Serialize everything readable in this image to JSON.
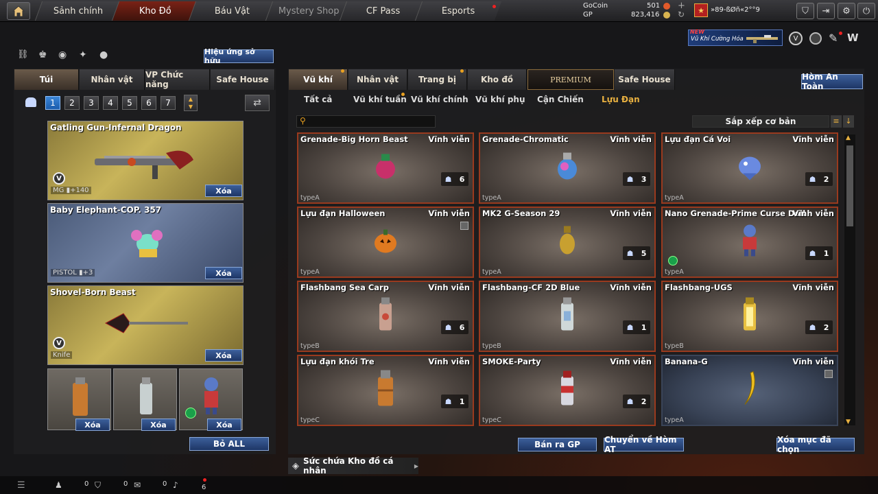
{
  "nav": {
    "tabs": [
      "Sảnh chính",
      "Kho Đồ",
      "Báu Vật",
      "Mystery Shop",
      "CF Pass",
      "Esports"
    ]
  },
  "currency": {
    "gocoin_label": "GoCoin",
    "gocoin": "501",
    "gp_label": "GP",
    "gp": "823,416"
  },
  "player": {
    "name": "»89-ßØñ«2°°9"
  },
  "promo": {
    "new": "NEW",
    "label": "Vũ Khí Cường Hóa"
  },
  "left": {
    "effect_button": "Hiệu ứng sở hữu",
    "tabs": [
      "Túi",
      "Nhân vật",
      "VP Chức năng",
      "Safe House"
    ],
    "pages": [
      "1",
      "2",
      "3",
      "4",
      "5",
      "6",
      "7"
    ],
    "cards": [
      {
        "name": "Gatling Gun-Infernal Dragon",
        "type": "MG",
        "bonus": "+140",
        "delete": "Xóa"
      },
      {
        "name": "Baby Elephant-COP. 357",
        "type": "PISTOL",
        "bonus": "+3",
        "delete": "Xóa"
      },
      {
        "name": "Shovel-Born Beast",
        "type": "Knife",
        "bonus": "",
        "delete": "Xóa"
      }
    ],
    "small_delete": "Xóa",
    "remove_all": "Bỏ ALL"
  },
  "right": {
    "tabs": [
      "Vũ khí",
      "Nhân vật",
      "Trang bị",
      "Kho đồ",
      "PREMIUM",
      "Safe House"
    ],
    "safe_box": "Hòm An Toàn",
    "subtabs": [
      "Tất cả",
      "Vũ khí tuần",
      "Vũ khí chính",
      "Vũ khí phụ",
      "Cận Chiến",
      "Lựu Đạn"
    ],
    "sort": "Sắp xếp cơ bản",
    "items": [
      {
        "name": "Grenade-Big Horn Beast",
        "perm": "Vĩnh viễn",
        "type": "typeA",
        "count": "6",
        "icon": "grenade-beast-icon"
      },
      {
        "name": "Grenade-Chromatic",
        "perm": "Vĩnh viễn",
        "type": "typeA",
        "count": "3",
        "icon": "grenade-chromatic-icon"
      },
      {
        "name": "Lựu đạn Cá Voi",
        "perm": "Vĩnh viễn",
        "type": "typeA",
        "count": "2",
        "icon": "whale-grenade-icon"
      },
      {
        "name": "Lựu đạn Halloween",
        "perm": "Vĩnh viễn",
        "type": "typeA",
        "count": "",
        "icon": "pumpkin-grenade-icon"
      },
      {
        "name": "MK2 G-Season 29",
        "perm": "Vĩnh viễn",
        "type": "typeA",
        "count": "5",
        "icon": "mk2-grenade-icon"
      },
      {
        "name": "Nano Grenade-Prime Curse Doll",
        "perm": "Vĩnh viễn",
        "type": "typeA",
        "count": "1",
        "icon": "doll-grenade-icon"
      },
      {
        "name": "Flashbang Sea Carp",
        "perm": "Vĩnh viễn",
        "type": "typeB",
        "count": "6",
        "icon": "flashbang-carp-icon"
      },
      {
        "name": "Flashbang-CF 2D Blue",
        "perm": "Vĩnh viễn",
        "type": "typeB",
        "count": "1",
        "icon": "flashbang-blue-icon"
      },
      {
        "name": "Flashbang-UGS",
        "perm": "Vĩnh viễn",
        "type": "typeB",
        "count": "2",
        "icon": "flashbang-ugs-icon"
      },
      {
        "name": "Lựu đạn khói Tre",
        "perm": "Vĩnh viễn",
        "type": "typeC",
        "count": "1",
        "icon": "smoke-bamboo-icon"
      },
      {
        "name": "SMOKE-Party",
        "perm": "Vĩnh viễn",
        "type": "typeC",
        "count": "2",
        "icon": "smoke-party-icon"
      },
      {
        "name": "Banana-G",
        "perm": "Vĩnh viễn",
        "type": "typeA",
        "count": "",
        "icon": "banana-icon"
      }
    ],
    "sell": "Bán ra GP",
    "move": "Chuyển về Hòm AT",
    "delete_selected": "Xóa mục đã chọn",
    "capacity": "Sức chứa Kho đồ cá nhân"
  },
  "footer": {
    "c1": "0",
    "c2": "0",
    "c3": "0",
    "c4": "6"
  }
}
